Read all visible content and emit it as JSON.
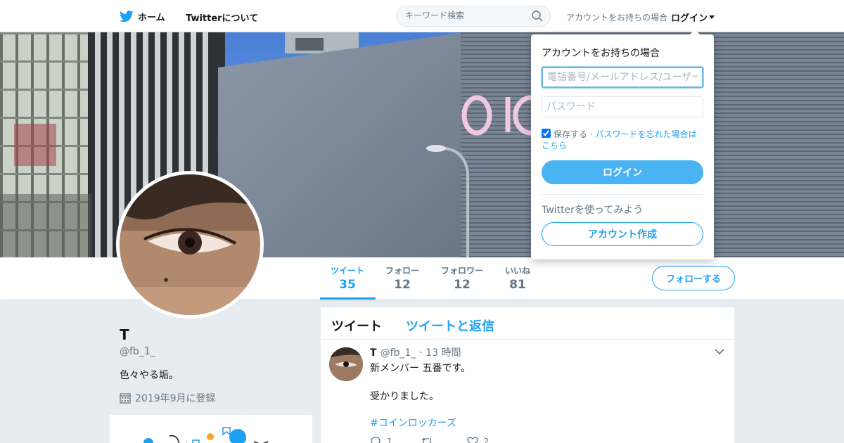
{
  "colors": {
    "brand": "#1da1f2",
    "text": "#14171a",
    "muted": "#657786",
    "background": "#e6ecf0"
  },
  "nav": {
    "home_label": "ホーム",
    "about_label": "Twitterについて",
    "search_placeholder": "キーワード検索",
    "have_account_text": "アカウントをお持ちの場合",
    "login_label": "ログイン"
  },
  "profile": {
    "name": "T",
    "handle": "@fb_1_",
    "bio": "色々やる垢。",
    "joined": "2019年9月に登録",
    "stats": [
      {
        "label": "ツイート",
        "value": "35"
      },
      {
        "label": "フォロー",
        "value": "12"
      },
      {
        "label": "フォロワー",
        "value": "12"
      },
      {
        "label": "いいね",
        "value": "81"
      }
    ],
    "follow_label": "フォローする"
  },
  "timeline": {
    "tabs": [
      "ツイート",
      "ツイートと返信"
    ],
    "tweet": {
      "name": "T",
      "handle": "@fb_1_",
      "time": "· 13 時間",
      "lines": [
        "新メンバー 五番です。",
        "受かりました。"
      ],
      "hashtag": "#コインロッカーズ",
      "reply_count": "1",
      "retweet_count": "",
      "like_count": "2"
    }
  },
  "login_dropdown": {
    "title": "アカウントをお持ちの場合",
    "username_placeholder": "電話番号/メールアドレス/ユーザー名",
    "password_placeholder": "パスワード",
    "remember_label": "保存する",
    "separator": "·",
    "forgot_label": "パスワードを忘れた場合はこちら",
    "login_button": "ログイン",
    "try_text": "Twitterを使ってみよう",
    "signup_button": "アカウント作成"
  },
  "icons": [
    "twitter-bird-icon",
    "search-icon",
    "caret-down-icon",
    "calendar-icon",
    "chevron-down-icon",
    "reply-icon",
    "retweet-icon",
    "heart-icon"
  ]
}
